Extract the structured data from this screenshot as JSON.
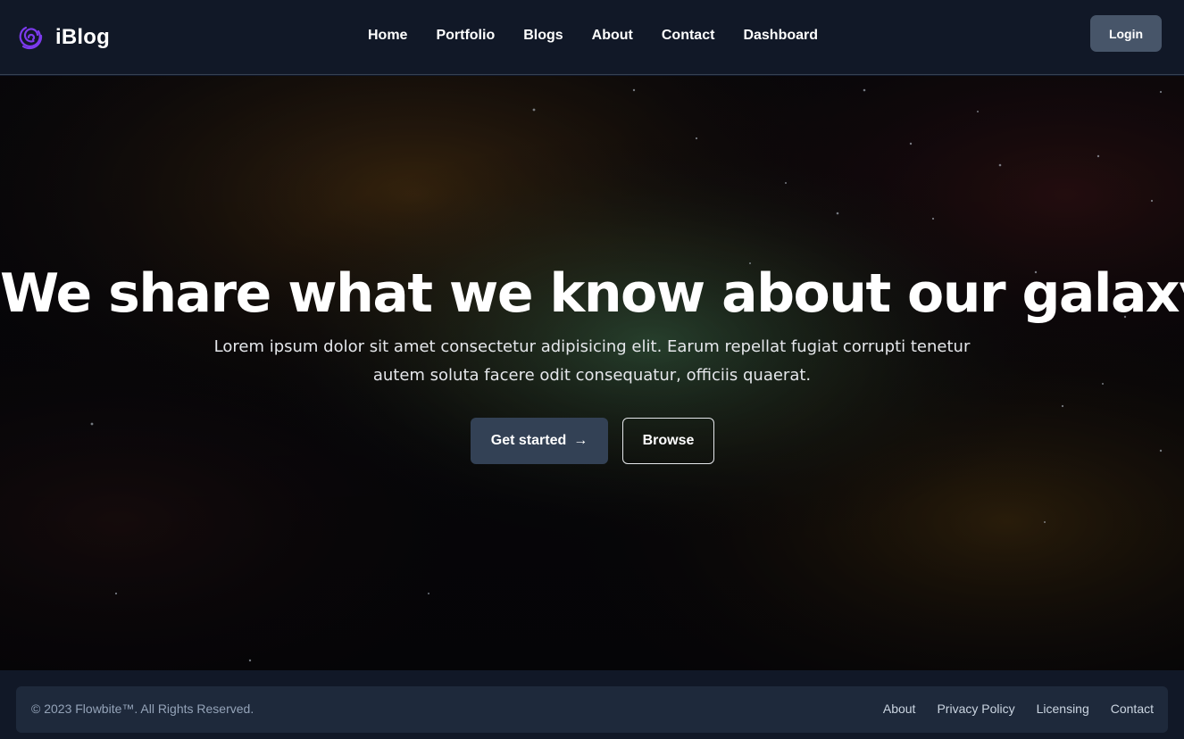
{
  "brand": {
    "name": "iBlog",
    "logo_icon": "galaxy-spiral-icon",
    "logo_color": "#7c3aed"
  },
  "nav": {
    "links": [
      "Home",
      "Portfolio",
      "Blogs",
      "About",
      "Contact",
      "Dashboard"
    ],
    "login_label": "Login"
  },
  "hero": {
    "title": "We share what we know about our galaxy",
    "text": "Lorem ipsum dolor sit amet consectetur adipisicing elit. Earum repellat fugiat corrupti tenetur autem soluta facere odit consequatur, officiis quaerat.",
    "primary_button": "Get started",
    "primary_button_icon": "arrow-right-icon",
    "arrow_glyph": "→",
    "secondary_button": "Browse"
  },
  "footer": {
    "copyright": "© 2023 Flowbite™. All Rights Reserved.",
    "links": [
      "About",
      "Privacy Policy",
      "Licensing",
      "Contact"
    ]
  },
  "colors": {
    "navbar_bg": "#111827",
    "login_bg": "#475569",
    "primary_button_bg": "#334155",
    "footer_bg": "#1e293b"
  }
}
